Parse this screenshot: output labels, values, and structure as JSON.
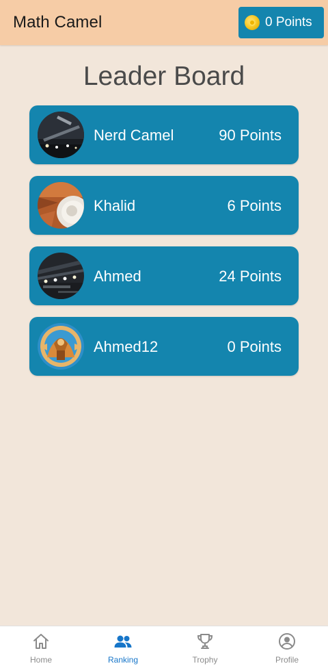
{
  "app": {
    "title": "Math Camel",
    "points_label": "0 Points"
  },
  "board": {
    "title": "Leader Board",
    "rows": [
      {
        "name": "Nerd Camel",
        "points": "90 Points",
        "avatar": "avatar-photo-dark-structure"
      },
      {
        "name": "Khalid",
        "points": "6 Points",
        "avatar": "avatar-photo-orange-mug"
      },
      {
        "name": "Ahmed",
        "points": "24 Points",
        "avatar": "avatar-photo-lit-ceiling"
      },
      {
        "name": "Ahmed12",
        "points": "0 Points",
        "avatar": "avatar-illustration-camel"
      }
    ]
  },
  "nav": {
    "items": [
      {
        "label": "Home",
        "icon": "home-icon",
        "active": false
      },
      {
        "label": "Ranking",
        "icon": "people-icon",
        "active": true
      },
      {
        "label": "Trophy",
        "icon": "trophy-icon",
        "active": false
      },
      {
        "label": "Profile",
        "icon": "profile-icon",
        "active": false
      }
    ]
  },
  "colors": {
    "appbar": "#f6cca6",
    "background": "#f2e6da",
    "card": "#1485ae",
    "active_nav": "#1776c9",
    "inactive_nav": "#8a8a8a"
  }
}
